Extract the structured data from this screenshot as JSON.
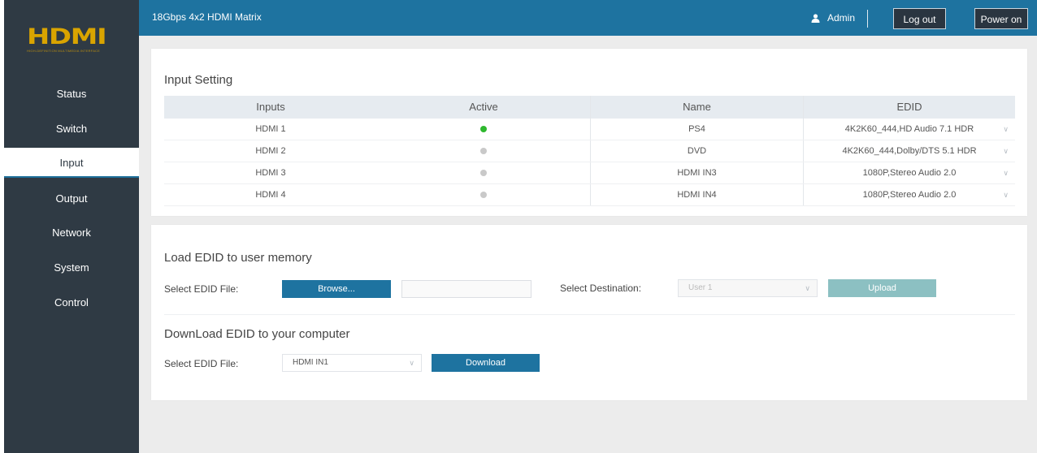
{
  "logo": {
    "text": "HDMI",
    "tagline": "HIGH-DEFINITION MULTIMEDIA INTERFACE"
  },
  "header": {
    "title": "18Gbps 4x2 HDMI Matrix",
    "user": "Admin",
    "logout_label": "Log out",
    "power_label": "Power on"
  },
  "sidebar": {
    "items": [
      {
        "label": "Status"
      },
      {
        "label": "Switch"
      },
      {
        "label": "Input"
      },
      {
        "label": "Output"
      },
      {
        "label": "Network"
      },
      {
        "label": "System"
      },
      {
        "label": "Control"
      }
    ],
    "active": "Input"
  },
  "input_setting": {
    "title": "Input Setting",
    "columns": [
      "Inputs",
      "Active",
      "Name",
      "EDID"
    ],
    "rows": [
      {
        "input": "HDMI 1",
        "active": true,
        "name": "PS4",
        "edid": "4K2K60_444,HD Audio 7.1 HDR"
      },
      {
        "input": "HDMI 2",
        "active": false,
        "name": "DVD",
        "edid": "4K2K60_444,Dolby/DTS 5.1 HDR"
      },
      {
        "input": "HDMI 3",
        "active": false,
        "name": "HDMI IN3",
        "edid": "1080P,Stereo Audio 2.0"
      },
      {
        "input": "HDMI 4",
        "active": false,
        "name": "HDMI IN4",
        "edid": "1080P,Stereo Audio 2.0"
      }
    ],
    "colors": {
      "active_dot": "#2eb82e",
      "inactive_dot": "#c9c9c9"
    }
  },
  "load_edid": {
    "title": "Load EDID to user memory",
    "select_file_label": "Select EDID File:",
    "browse_label": "Browse...",
    "file_value": "",
    "select_destination_label": "Select Destination:",
    "destination_value": "User 1",
    "upload_label": "Upload"
  },
  "download_edid": {
    "title": "DownLoad EDID to your computer",
    "select_file_label": "Select EDID File:",
    "file_select_value": "HDMI IN1",
    "download_label": "Download"
  },
  "colors": {
    "sidebar_bg": "#2f3a44",
    "header_bg": "#1e73a0",
    "accent": "#1e73a0",
    "logo": "#d9a400"
  }
}
